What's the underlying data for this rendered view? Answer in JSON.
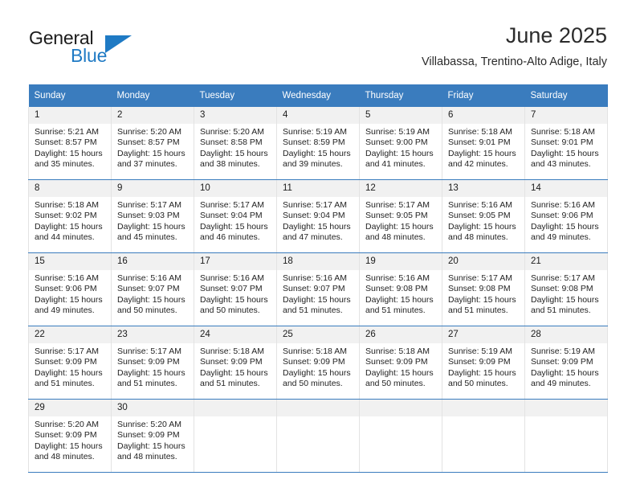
{
  "brand": {
    "name_top": "General",
    "name_bottom": "Blue",
    "accent_color": "#1f7ac4"
  },
  "header": {
    "title": "June 2025",
    "subtitle": "Villabassa, Trentino-Alto Adige, Italy"
  },
  "calendar": {
    "header_bg": "#3a7cbe",
    "daynum_bg": "#f1f1f1",
    "weekday_headers": [
      "Sunday",
      "Monday",
      "Tuesday",
      "Wednesday",
      "Thursday",
      "Friday",
      "Saturday"
    ],
    "weeks": [
      [
        {
          "day": "1",
          "sunrise": "Sunrise: 5:21 AM",
          "sunset": "Sunset: 8:57 PM",
          "daylight_line1": "Daylight: 15 hours",
          "daylight_line2": "and 35 minutes."
        },
        {
          "day": "2",
          "sunrise": "Sunrise: 5:20 AM",
          "sunset": "Sunset: 8:57 PM",
          "daylight_line1": "Daylight: 15 hours",
          "daylight_line2": "and 37 minutes."
        },
        {
          "day": "3",
          "sunrise": "Sunrise: 5:20 AM",
          "sunset": "Sunset: 8:58 PM",
          "daylight_line1": "Daylight: 15 hours",
          "daylight_line2": "and 38 minutes."
        },
        {
          "day": "4",
          "sunrise": "Sunrise: 5:19 AM",
          "sunset": "Sunset: 8:59 PM",
          "daylight_line1": "Daylight: 15 hours",
          "daylight_line2": "and 39 minutes."
        },
        {
          "day": "5",
          "sunrise": "Sunrise: 5:19 AM",
          "sunset": "Sunset: 9:00 PM",
          "daylight_line1": "Daylight: 15 hours",
          "daylight_line2": "and 41 minutes."
        },
        {
          "day": "6",
          "sunrise": "Sunrise: 5:18 AM",
          "sunset": "Sunset: 9:01 PM",
          "daylight_line1": "Daylight: 15 hours",
          "daylight_line2": "and 42 minutes."
        },
        {
          "day": "7",
          "sunrise": "Sunrise: 5:18 AM",
          "sunset": "Sunset: 9:01 PM",
          "daylight_line1": "Daylight: 15 hours",
          "daylight_line2": "and 43 minutes."
        }
      ],
      [
        {
          "day": "8",
          "sunrise": "Sunrise: 5:18 AM",
          "sunset": "Sunset: 9:02 PM",
          "daylight_line1": "Daylight: 15 hours",
          "daylight_line2": "and 44 minutes."
        },
        {
          "day": "9",
          "sunrise": "Sunrise: 5:17 AM",
          "sunset": "Sunset: 9:03 PM",
          "daylight_line1": "Daylight: 15 hours",
          "daylight_line2": "and 45 minutes."
        },
        {
          "day": "10",
          "sunrise": "Sunrise: 5:17 AM",
          "sunset": "Sunset: 9:04 PM",
          "daylight_line1": "Daylight: 15 hours",
          "daylight_line2": "and 46 minutes."
        },
        {
          "day": "11",
          "sunrise": "Sunrise: 5:17 AM",
          "sunset": "Sunset: 9:04 PM",
          "daylight_line1": "Daylight: 15 hours",
          "daylight_line2": "and 47 minutes."
        },
        {
          "day": "12",
          "sunrise": "Sunrise: 5:17 AM",
          "sunset": "Sunset: 9:05 PM",
          "daylight_line1": "Daylight: 15 hours",
          "daylight_line2": "and 48 minutes."
        },
        {
          "day": "13",
          "sunrise": "Sunrise: 5:16 AM",
          "sunset": "Sunset: 9:05 PM",
          "daylight_line1": "Daylight: 15 hours",
          "daylight_line2": "and 48 minutes."
        },
        {
          "day": "14",
          "sunrise": "Sunrise: 5:16 AM",
          "sunset": "Sunset: 9:06 PM",
          "daylight_line1": "Daylight: 15 hours",
          "daylight_line2": "and 49 minutes."
        }
      ],
      [
        {
          "day": "15",
          "sunrise": "Sunrise: 5:16 AM",
          "sunset": "Sunset: 9:06 PM",
          "daylight_line1": "Daylight: 15 hours",
          "daylight_line2": "and 49 minutes."
        },
        {
          "day": "16",
          "sunrise": "Sunrise: 5:16 AM",
          "sunset": "Sunset: 9:07 PM",
          "daylight_line1": "Daylight: 15 hours",
          "daylight_line2": "and 50 minutes."
        },
        {
          "day": "17",
          "sunrise": "Sunrise: 5:16 AM",
          "sunset": "Sunset: 9:07 PM",
          "daylight_line1": "Daylight: 15 hours",
          "daylight_line2": "and 50 minutes."
        },
        {
          "day": "18",
          "sunrise": "Sunrise: 5:16 AM",
          "sunset": "Sunset: 9:07 PM",
          "daylight_line1": "Daylight: 15 hours",
          "daylight_line2": "and 51 minutes."
        },
        {
          "day": "19",
          "sunrise": "Sunrise: 5:16 AM",
          "sunset": "Sunset: 9:08 PM",
          "daylight_line1": "Daylight: 15 hours",
          "daylight_line2": "and 51 minutes."
        },
        {
          "day": "20",
          "sunrise": "Sunrise: 5:17 AM",
          "sunset": "Sunset: 9:08 PM",
          "daylight_line1": "Daylight: 15 hours",
          "daylight_line2": "and 51 minutes."
        },
        {
          "day": "21",
          "sunrise": "Sunrise: 5:17 AM",
          "sunset": "Sunset: 9:08 PM",
          "daylight_line1": "Daylight: 15 hours",
          "daylight_line2": "and 51 minutes."
        }
      ],
      [
        {
          "day": "22",
          "sunrise": "Sunrise: 5:17 AM",
          "sunset": "Sunset: 9:09 PM",
          "daylight_line1": "Daylight: 15 hours",
          "daylight_line2": "and 51 minutes."
        },
        {
          "day": "23",
          "sunrise": "Sunrise: 5:17 AM",
          "sunset": "Sunset: 9:09 PM",
          "daylight_line1": "Daylight: 15 hours",
          "daylight_line2": "and 51 minutes."
        },
        {
          "day": "24",
          "sunrise": "Sunrise: 5:18 AM",
          "sunset": "Sunset: 9:09 PM",
          "daylight_line1": "Daylight: 15 hours",
          "daylight_line2": "and 51 minutes."
        },
        {
          "day": "25",
          "sunrise": "Sunrise: 5:18 AM",
          "sunset": "Sunset: 9:09 PM",
          "daylight_line1": "Daylight: 15 hours",
          "daylight_line2": "and 50 minutes."
        },
        {
          "day": "26",
          "sunrise": "Sunrise: 5:18 AM",
          "sunset": "Sunset: 9:09 PM",
          "daylight_line1": "Daylight: 15 hours",
          "daylight_line2": "and 50 minutes."
        },
        {
          "day": "27",
          "sunrise": "Sunrise: 5:19 AM",
          "sunset": "Sunset: 9:09 PM",
          "daylight_line1": "Daylight: 15 hours",
          "daylight_line2": "and 50 minutes."
        },
        {
          "day": "28",
          "sunrise": "Sunrise: 5:19 AM",
          "sunset": "Sunset: 9:09 PM",
          "daylight_line1": "Daylight: 15 hours",
          "daylight_line2": "and 49 minutes."
        }
      ],
      [
        {
          "day": "29",
          "sunrise": "Sunrise: 5:20 AM",
          "sunset": "Sunset: 9:09 PM",
          "daylight_line1": "Daylight: 15 hours",
          "daylight_line2": "and 48 minutes."
        },
        {
          "day": "30",
          "sunrise": "Sunrise: 5:20 AM",
          "sunset": "Sunset: 9:09 PM",
          "daylight_line1": "Daylight: 15 hours",
          "daylight_line2": "and 48 minutes."
        },
        {
          "day": "",
          "sunrise": "",
          "sunset": "",
          "daylight_line1": "",
          "daylight_line2": ""
        },
        {
          "day": "",
          "sunrise": "",
          "sunset": "",
          "daylight_line1": "",
          "daylight_line2": ""
        },
        {
          "day": "",
          "sunrise": "",
          "sunset": "",
          "daylight_line1": "",
          "daylight_line2": ""
        },
        {
          "day": "",
          "sunrise": "",
          "sunset": "",
          "daylight_line1": "",
          "daylight_line2": ""
        },
        {
          "day": "",
          "sunrise": "",
          "sunset": "",
          "daylight_line1": "",
          "daylight_line2": ""
        }
      ]
    ]
  }
}
